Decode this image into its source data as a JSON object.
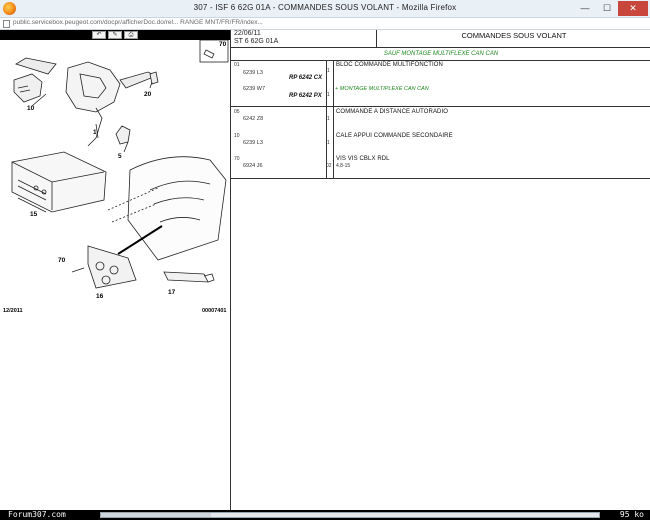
{
  "window": {
    "title": "307 - ISF 6 62G 01A - COMMANDES SOUS VOLANT - Mozilla Firefox",
    "minimize": "—",
    "maximize": "☐",
    "close": "✕"
  },
  "address": {
    "url": "public.servicebox.peugeot.com/docpr/afficherDoc.do/rel... RANGE MNT/FR/FR/index..."
  },
  "drawing": {
    "toolbar_buttons": [
      "↶",
      "✎",
      "⎙"
    ],
    "callouts": {
      "c70a": "70",
      "c20": "20",
      "c10": "10",
      "c1": "1",
      "c5": "5",
      "c15": "15",
      "c70b": "70",
      "c16": "16",
      "c17": "17"
    },
    "footer_date": "12/2011",
    "footer_code": "00007401"
  },
  "parts": {
    "date": "22/06/11",
    "reference": "ST 6 62G 01A",
    "title": "COMMANDES SOUS VOLANT",
    "condition_note": "SAUF MONTAGE MULTIFLEXE CAN CAN",
    "rows": [
      {
        "index": "01",
        "qty1": "1",
        "qty2": "1",
        "sub1_ref": "6239 L3",
        "sub1_code": "RP 6242 CX",
        "sub2_ref": "6239 W7",
        "sub2_code": "RP 6242 PX",
        "description": "BLOC COMMANDE MULTIFONCTION",
        "note": "+ MONTAGE MULTIPLEXE CAN CAN"
      },
      {
        "index": "05",
        "ref": "6242 Z8",
        "qty": "1",
        "description": "COMMANDE A DISTANCE AUTORADIO"
      },
      {
        "index": "10",
        "ref": "6239 L3",
        "qty": "1",
        "description": "CALE APPUI COMMANDE SECONDAIRE"
      },
      {
        "index": "70",
        "ref": "6924 J6",
        "qty": "02",
        "description": "VIS VIS CBLX RDL",
        "note": "4.8-15"
      }
    ]
  },
  "status": {
    "left_text": "Forum307.com",
    "right_text": "95 ko",
    "progress_fraction": 0.22
  },
  "colors": {
    "note_green": "#1f8a1f",
    "close_red": "#c9463d"
  }
}
